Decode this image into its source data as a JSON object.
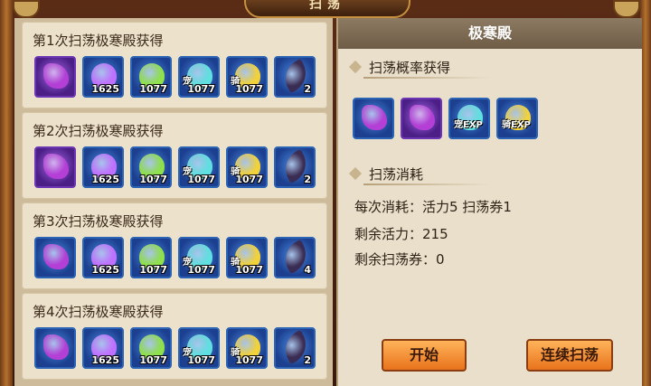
{
  "window": {
    "title": "扫荡"
  },
  "drops": {
    "sections": [
      {
        "title": "第1次扫荡极寒殿获得",
        "items": [
          {
            "icon": "dragon-icon",
            "frame": "purple",
            "tag": "",
            "count": ""
          },
          {
            "icon": "purple-orb-icon",
            "frame": "blue",
            "tag": "",
            "count": "1625"
          },
          {
            "icon": "green-exp-icon",
            "frame": "blue",
            "tag": "",
            "count": "1077"
          },
          {
            "icon": "cyan-pet-exp-icon",
            "frame": "blue",
            "tag": "宠",
            "count": "1077"
          },
          {
            "icon": "yellow-mount-exp-icon",
            "frame": "blue",
            "tag": "骑",
            "count": "1077"
          },
          {
            "icon": "feather-icon",
            "frame": "blue",
            "tag": "",
            "count": "2"
          }
        ]
      },
      {
        "title": "第2次扫荡极寒殿获得",
        "items": [
          {
            "icon": "dragon-icon",
            "frame": "purple",
            "tag": "",
            "count": ""
          },
          {
            "icon": "purple-orb-icon",
            "frame": "blue",
            "tag": "",
            "count": "1625"
          },
          {
            "icon": "green-exp-icon",
            "frame": "blue",
            "tag": "",
            "count": "1077"
          },
          {
            "icon": "cyan-pet-exp-icon",
            "frame": "blue",
            "tag": "宠",
            "count": "1077"
          },
          {
            "icon": "yellow-mount-exp-icon",
            "frame": "blue",
            "tag": "骑",
            "count": "1077"
          },
          {
            "icon": "feather-icon",
            "frame": "blue",
            "tag": "",
            "count": "2"
          }
        ]
      },
      {
        "title": "第3次扫荡极寒殿获得",
        "items": [
          {
            "icon": "dragon-icon",
            "frame": "blue",
            "tag": "",
            "count": ""
          },
          {
            "icon": "purple-orb-icon",
            "frame": "blue",
            "tag": "",
            "count": "1625"
          },
          {
            "icon": "green-exp-icon",
            "frame": "blue",
            "tag": "",
            "count": "1077"
          },
          {
            "icon": "cyan-pet-exp-icon",
            "frame": "blue",
            "tag": "宠",
            "count": "1077"
          },
          {
            "icon": "yellow-mount-exp-icon",
            "frame": "blue",
            "tag": "骑",
            "count": "1077"
          },
          {
            "icon": "feather-icon",
            "frame": "blue",
            "tag": "",
            "count": "4"
          }
        ]
      },
      {
        "title": "第4次扫荡极寒殿获得",
        "items": [
          {
            "icon": "dragon-icon",
            "frame": "blue",
            "tag": "",
            "count": ""
          },
          {
            "icon": "purple-orb-icon",
            "frame": "blue",
            "tag": "",
            "count": "1625"
          },
          {
            "icon": "green-exp-icon",
            "frame": "blue",
            "tag": "",
            "count": "1077"
          },
          {
            "icon": "cyan-pet-exp-icon",
            "frame": "blue",
            "tag": "宠",
            "count": "1077"
          },
          {
            "icon": "yellow-mount-exp-icon",
            "frame": "blue",
            "tag": "骑",
            "count": "1077"
          },
          {
            "icon": "feather-icon",
            "frame": "blue",
            "tag": "",
            "count": "2"
          }
        ]
      }
    ]
  },
  "info": {
    "title": "极寒殿",
    "probability_heading": "扫荡概率获得",
    "probability_items": [
      {
        "icon": "dragon-icon",
        "frame": "blue",
        "label": ""
      },
      {
        "icon": "dragon-icon",
        "frame": "purple",
        "label": ""
      },
      {
        "icon": "cyan-pet-exp-icon",
        "frame": "blue",
        "label": "宠EXP"
      },
      {
        "icon": "yellow-mount-exp-icon",
        "frame": "blue",
        "label": "骑EXP"
      }
    ],
    "cost_heading": "扫荡消耗",
    "cost_line": "每次消耗：活力5 扫荡券1",
    "vitality_line": "剩余活力：215",
    "tickets_line": "剩余扫荡券：0",
    "start_label": "开始",
    "continuous_label": "连续扫荡"
  },
  "colors": {
    "dragon-icon": "#b33fd6",
    "purple-orb-icon": "#c070ff",
    "green-exp-icon": "#8fe04a",
    "cyan-pet-exp-icon": "#5fe0e0",
    "yellow-mount-exp-icon": "#f2d23a",
    "feather-icon": "#3a2c52"
  }
}
